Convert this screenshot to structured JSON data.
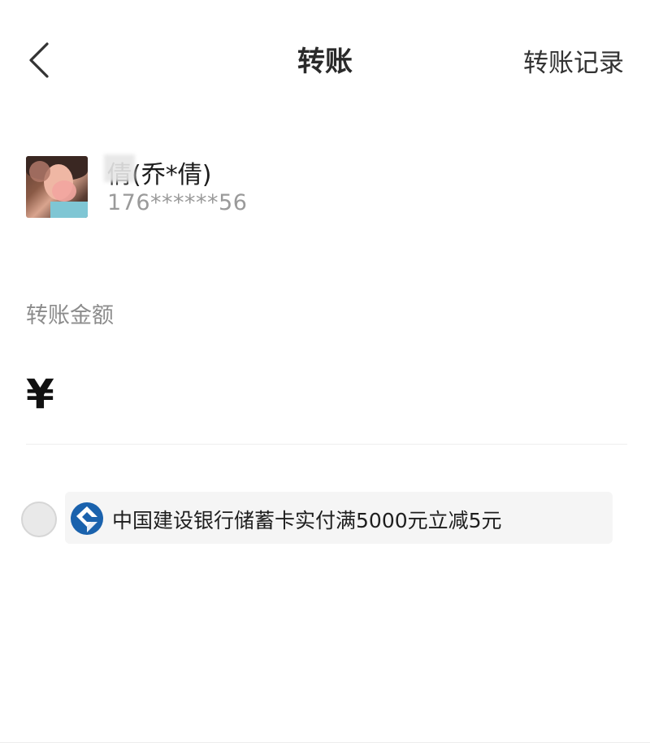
{
  "nav": {
    "title": "转账",
    "history_label": "转账记录"
  },
  "recipient": {
    "name": "倩(乔*倩)",
    "phone": "176******56"
  },
  "amount": {
    "label": "转账金额",
    "currency_symbol": "¥",
    "value": ""
  },
  "promotion": {
    "bank_icon": "ccb-bank-logo",
    "text": "中国建设银行储蓄卡实付满5000元立减5元",
    "selected": false
  },
  "colors": {
    "bank_blue": "#1a62ad",
    "label_gray": "#8c8c8c",
    "background": "#ffffff"
  }
}
